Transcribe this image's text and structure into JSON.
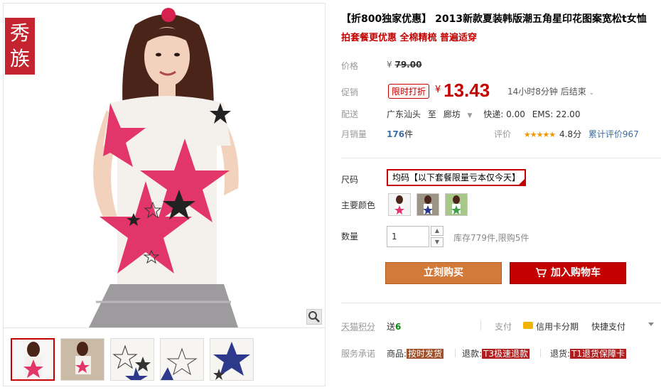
{
  "gallery": {
    "brand_logo": "秀族",
    "thumbnail_count": 5,
    "active_thumbnail": 1
  },
  "product": {
    "title": "【折800独家优惠】 2013新款夏装韩版潮五角星印花图案宽松t女恤",
    "subtitle": "拍套餐更优惠 全棉精梳 普遍适穿"
  },
  "price": {
    "label": "价格",
    "currency": "¥",
    "original": "79.00",
    "promo_label": "促销",
    "promo_tag": "限时打折",
    "current": "13.43",
    "countdown": "14小时8分钟 后结束"
  },
  "shipping": {
    "label": "配送",
    "from": "广东汕头",
    "to_word": "至",
    "to": "廊坊",
    "express": "快递: 0.00",
    "ems": "EMS: 22.00"
  },
  "sales": {
    "label": "月销量",
    "count": "176",
    "unit": "件",
    "review_label": "评价",
    "stars": 4.8,
    "score": "4.8分",
    "review_link": "累计评价967"
  },
  "options": {
    "size_label": "尺码",
    "size_value": "均码【以下套餐限量亏本仅今天】",
    "color_label": "主要颜色",
    "quantity_label": "数量",
    "quantity_value": "1",
    "stock": "库存779件,限购5件"
  },
  "actions": {
    "buy_now": "立刻购买",
    "add_to_cart": "加入购物车"
  },
  "extras": {
    "points_label": "天猫积分",
    "points_text": "送",
    "points_value": "6",
    "pay_label": "支付",
    "pay_card": "信用卡分期",
    "pay_quick": "快捷支付",
    "service_label": "服务承诺",
    "svc_goods": "商品:",
    "svc_goods_tag": "按时发货",
    "svc_refund": "退款:",
    "svc_refund_tag": "T3极速退款",
    "svc_return": "退货:",
    "svc_return_tag": "T1退货保障卡"
  },
  "colors": {
    "accent_red": "#c40000",
    "buy_orange": "#d27a3a",
    "pink_star": "#e2356a"
  }
}
